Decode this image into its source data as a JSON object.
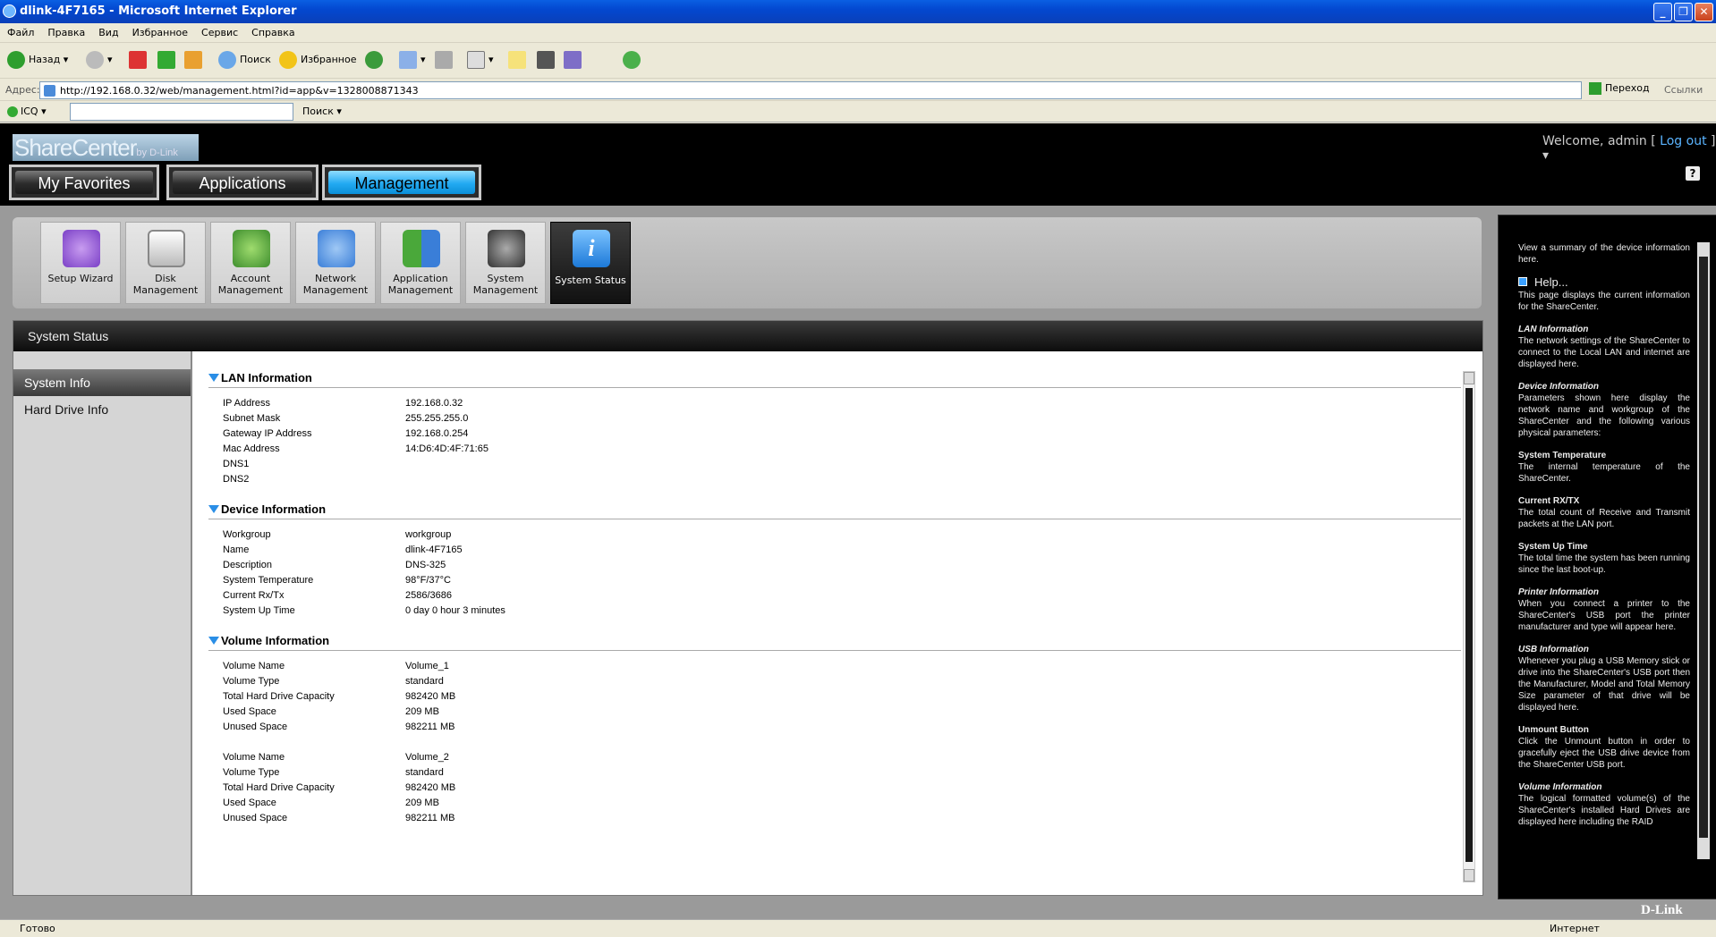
{
  "window": {
    "title": "dlink-4F7165 - Microsoft Internet Explorer"
  },
  "menu": [
    "Файл",
    "Правка",
    "Вид",
    "Избранное",
    "Сервис",
    "Справка"
  ],
  "toolbar": {
    "back": "Назад",
    "search": "Поиск",
    "favorites": "Избранное"
  },
  "address": {
    "label": "Адрес:",
    "url": "http://192.168.0.32/web/management.html?id=app&v=1328008871343",
    "go": "Переход",
    "links": "Ссылки"
  },
  "icqbar": {
    "icq": "ICQ",
    "search": "Поиск"
  },
  "app": {
    "logo": "ShareCenter",
    "logo_sub": "by D-Link",
    "welcome": "Welcome, admin [",
    "logout": "Log out",
    "welcome_end": "]",
    "help_q": "?",
    "tabs": [
      "My Favorites",
      "Applications",
      "Management"
    ],
    "icons": [
      {
        "label": "Setup Wizard",
        "icon": "wizard-icon",
        "color": "#7a3fc6"
      },
      {
        "label": "Disk Management",
        "icon": "disk-icon",
        "color": "#d9d9d9"
      },
      {
        "label": "Account Management",
        "icon": "account-icon",
        "color": "#3e8e2e"
      },
      {
        "label": "Network Management",
        "icon": "network-icon",
        "color": "#3a7ed8"
      },
      {
        "label": "Application Management",
        "icon": "application-icon",
        "color": "#4aa83a"
      },
      {
        "label": "System Management",
        "icon": "system-icon",
        "color": "#555555"
      },
      {
        "label": "System Status",
        "icon": "info-icon",
        "color": "#2a8ee6"
      }
    ],
    "panel_title": "System Status",
    "nav": [
      "System Info",
      "Hard Drive Info"
    ],
    "lan": {
      "title": "LAN Information",
      "rows": [
        [
          "IP Address",
          "192.168.0.32"
        ],
        [
          "Subnet Mask",
          "255.255.255.0"
        ],
        [
          "Gateway IP Address",
          "192.168.0.254"
        ],
        [
          "Mac Address",
          "14:D6:4D:4F:71:65"
        ],
        [
          "DNS1",
          ""
        ],
        [
          "DNS2",
          ""
        ]
      ]
    },
    "device": {
      "title": "Device Information",
      "rows": [
        [
          "Workgroup",
          "workgroup"
        ],
        [
          "Name",
          "dlink-4F7165"
        ],
        [
          "Description",
          "DNS-325"
        ],
        [
          "System Temperature",
          "98°F/37°C"
        ],
        [
          "Current Rx/Tx",
          "2586/3686"
        ],
        [
          "System Up Time",
          "0 day  0 hour  3 minutes"
        ]
      ]
    },
    "volume": {
      "title": "Volume Information",
      "rows": [
        [
          "Volume Name",
          "Volume_1"
        ],
        [
          "Volume Type",
          "standard"
        ],
        [
          "Total Hard Drive Capacity",
          "982420 MB"
        ],
        [
          "Used Space",
          "209 MB"
        ],
        [
          "Unused Space",
          "982211 MB"
        ],
        [
          "Volume Name",
          "Volume_2"
        ],
        [
          "Volume Type",
          "standard"
        ],
        [
          "Total Hard Drive Capacity",
          "982420 MB"
        ],
        [
          "Used Space",
          "209 MB"
        ],
        [
          "Unused Space",
          "982211 MB"
        ]
      ]
    },
    "help": {
      "intro": "View a summary of the device information here.",
      "link": "Help...",
      "p1": "This page displays the current information for the ShareCenter.",
      "items": [
        {
          "h": "LAN Information",
          "t": "The network settings of the ShareCenter to connect to the Local LAN and internet are displayed here.",
          "italic": true
        },
        {
          "h": "Device Information",
          "t": "Parameters shown here display the network name and workgroup of the ShareCenter and the following various physical parameters:",
          "italic": true
        },
        {
          "h": "System Temperature",
          "t": "The internal temperature of the ShareCenter.",
          "italic": false
        },
        {
          "h": "Current RX/TX",
          "t": "The total count of Receive and Transmit packets at the LAN port.",
          "italic": false
        },
        {
          "h": "System Up Time",
          "t": "The total time the system has been running since the last boot-up.",
          "italic": false
        },
        {
          "h": "Printer Information",
          "t": "When you connect a printer to the ShareCenter's USB port the printer manufacturer and type will appear here.",
          "italic": true
        },
        {
          "h": "USB Information",
          "t": "Whenever you plug a USB Memory stick or drive into the ShareCenter's USB port then the Manufacturer, Model and Total Memory Size parameter of that drive will be displayed here.",
          "italic": true
        },
        {
          "h": "Unmount Button",
          "t": "Click the Unmount button in order to gracefully eject the USB drive device from the ShareCenter USB port.",
          "italic": false
        },
        {
          "h": "Volume Information",
          "t": "The logical formatted volume(s) of the ShareCenter's installed Hard Drives are displayed here including the RAID",
          "italic": true
        }
      ]
    },
    "brand": "D-Link"
  },
  "status": {
    "left": "Готово",
    "right": "Интернет"
  }
}
